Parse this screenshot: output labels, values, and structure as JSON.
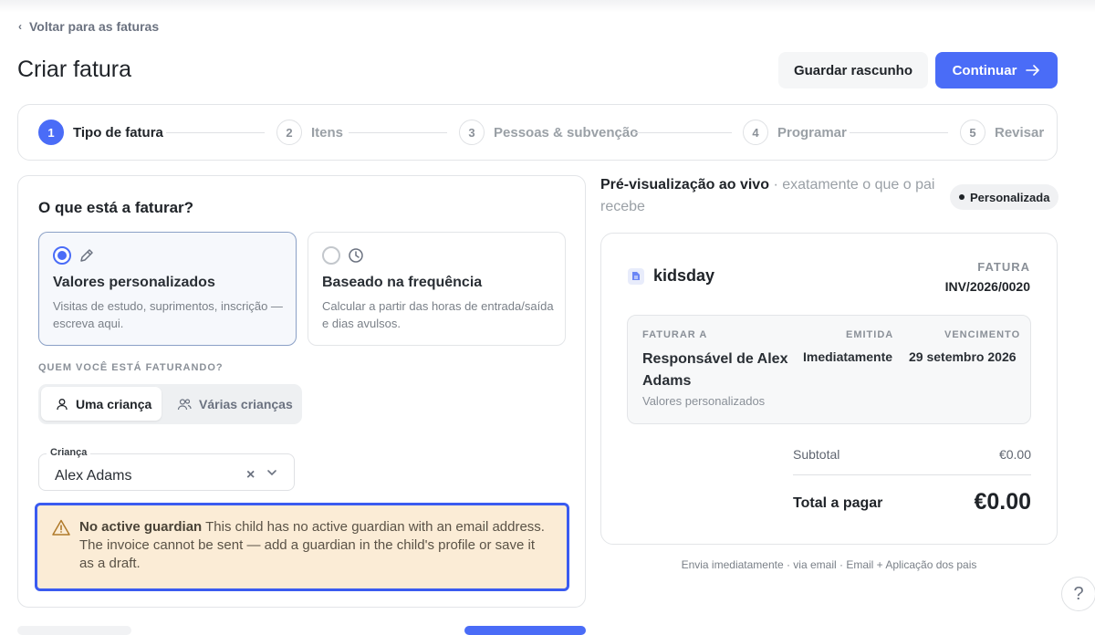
{
  "nav": {
    "back_label": "Voltar para as faturas"
  },
  "page": {
    "title": "Criar fatura"
  },
  "actions": {
    "draft_label": "Guardar rascunho",
    "continue_label": "Continuar"
  },
  "steps": [
    {
      "num": "1",
      "label": "Tipo de fatura"
    },
    {
      "num": "2",
      "label": "Itens"
    },
    {
      "num": "3",
      "label": "Pessoas & subvenção"
    },
    {
      "num": "4",
      "label": "Programar"
    },
    {
      "num": "5",
      "label": "Revisar"
    }
  ],
  "form": {
    "question": "O que está a faturar?",
    "options": [
      {
        "title": "Valores personalizados",
        "desc": "Visitas de estudo, suprimentos, inscrição — escreva aqui."
      },
      {
        "title": "Baseado na frequência",
        "desc": "Calcular a partir das horas de entrada/saída e dias avulsos."
      }
    ],
    "who_label": "QUEM VOCÊ ESTÁ FATURANDO?",
    "who_options": [
      "Uma criança",
      "Várias crianças"
    ],
    "child_label": "Criança",
    "child_value": "Alex Adams",
    "warning_title": "No active guardian",
    "warning_text": "This child has no active guardian with an email address. The invoice cannot be sent — add a guardian in the child's profile or save it as a draft."
  },
  "preview": {
    "heading": "Pré-visualização ao vivo",
    "subheading": "· exatamente o que o pai recebe",
    "badge": "Personalizada",
    "brand": "kidsday",
    "invoice_label": "FATURA",
    "invoice_number": "INV/2026/0020",
    "bill_to_label": "FATURAR A",
    "bill_to_name": "Responsável de Alex Adams",
    "bill_to_sub": "Valores personalizados",
    "issued_label": "EMITIDA",
    "issued_value": "Imediatamente",
    "due_label": "VENCIMENTO",
    "due_value": "29 setembro 2026",
    "subtotal_label": "Subtotal",
    "subtotal_value": "€0.00",
    "total_label": "Total a pagar",
    "total_value": "€0.00",
    "send_note": "Envia imediatamente · via email · Email + Aplicação dos pais"
  },
  "help": {
    "label": "?"
  },
  "colors": {
    "accent": "#4a6cf7",
    "warning_bg": "#fbecd6",
    "warning_border": "#3a5bf0"
  }
}
